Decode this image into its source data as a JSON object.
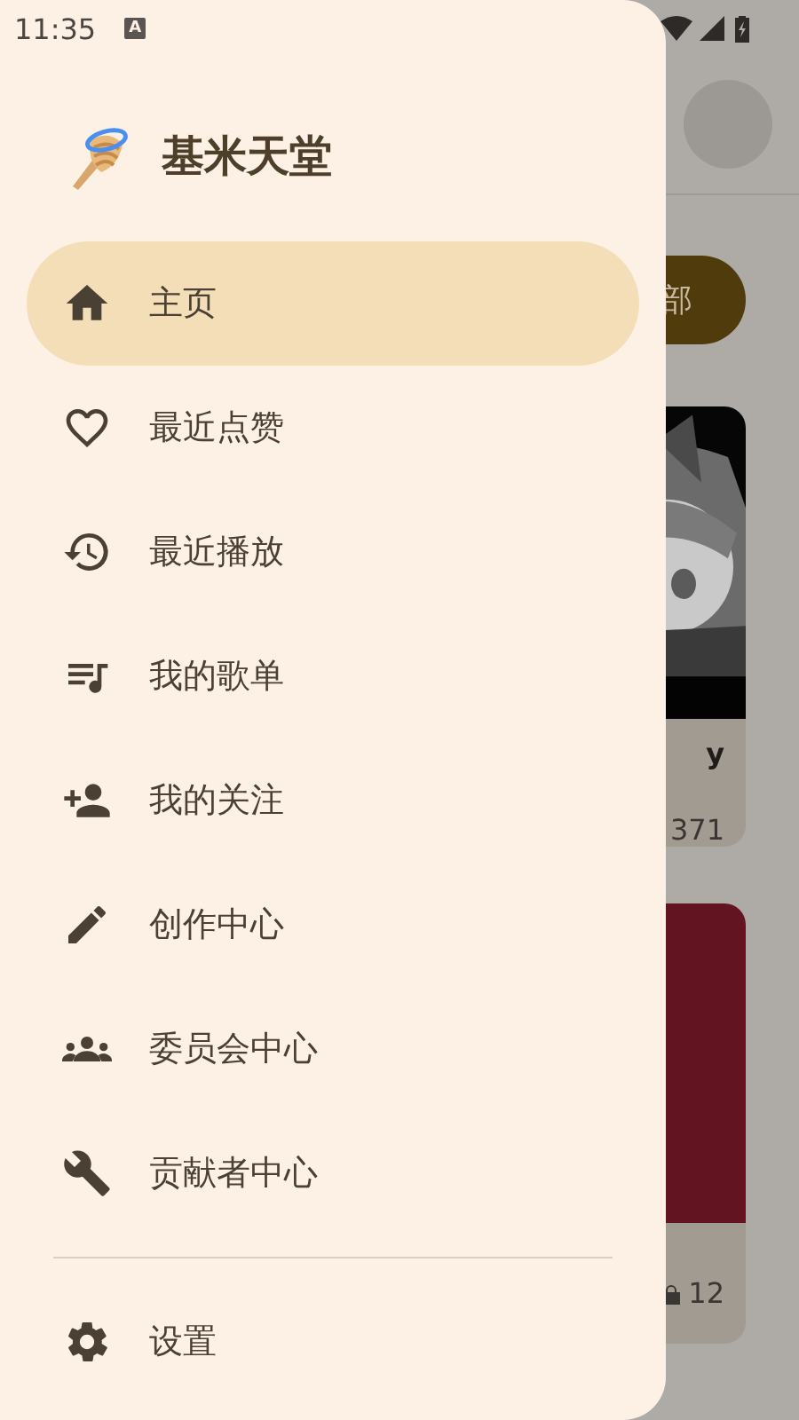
{
  "status_bar": {
    "time": "11:35",
    "keyboard_badge": "A"
  },
  "background_app": {
    "filter_button": "部",
    "cards": [
      {
        "kind": "picture",
        "title": "y",
        "stat": "371"
      },
      {
        "kind": "flat",
        "stat": "12"
      }
    ]
  },
  "drawer": {
    "title": "基米天堂",
    "items": [
      {
        "label": "主页",
        "selected": true
      },
      {
        "label": "最近点赞",
        "selected": false
      },
      {
        "label": "最近播放",
        "selected": false
      },
      {
        "label": "我的歌单",
        "selected": false
      },
      {
        "label": "我的关注",
        "selected": false
      },
      {
        "label": "创作中心",
        "selected": false
      },
      {
        "label": "委员会中心",
        "selected": false
      },
      {
        "label": "贡献者中心",
        "selected": false
      }
    ],
    "footer_items": [
      {
        "label": "设置",
        "selected": false
      }
    ]
  }
}
